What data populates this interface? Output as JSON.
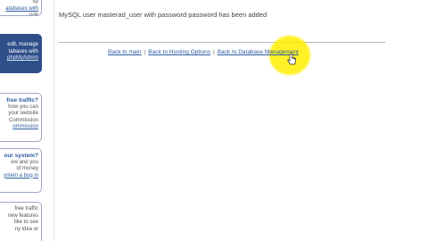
{
  "main": {
    "message": "MySQL user masterad_user with password password has been added",
    "links": [
      "Back to main",
      "Back to Hosting Options",
      "Back to Database Management"
    ],
    "separator": "|"
  },
  "sidebar": {
    "top": [
      "ftp",
      "atabases with",
      "ode"
    ],
    "manage": [
      "edit, manage",
      "tabases with",
      "phpMyAdmin"
    ],
    "traffic": [
      "free traffic?",
      "how you can",
      "your website",
      "Commission",
      "ommission"
    ],
    "system": [
      "our system?",
      "ew and you",
      "of money",
      "ystem a bug in"
    ],
    "features": [
      "free traffic",
      "new features",
      "like to see",
      "ny idea or"
    ]
  },
  "colors": {
    "link": "#2c5aa0",
    "highlight": "#ffee00",
    "sidebar_dark": "#2f4f8a"
  },
  "icons": {
    "cursor": "hand-pointer-icon"
  }
}
